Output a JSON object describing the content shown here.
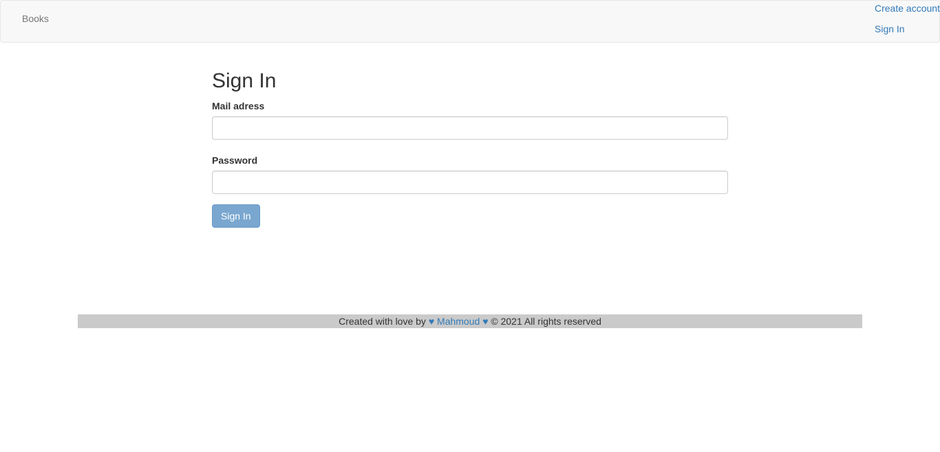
{
  "navbar": {
    "brand": "Books",
    "links": [
      {
        "label": "Create account"
      },
      {
        "label": "Sign In"
      }
    ]
  },
  "form": {
    "title": "Sign In",
    "email_label": "Mail adress",
    "email_value": "",
    "password_label": "Password",
    "password_value": "",
    "submit_label": "Sign In"
  },
  "footer": {
    "prefix": "Created with love by",
    "heart_icon": "♥",
    "author": "Mahmoud",
    "suffix": "© 2021 All rights reserved"
  },
  "colors": {
    "navbar_bg": "#f8f8f8",
    "link": "#337ab7",
    "button_bg": "#7aa7cf",
    "footer_bg": "#cacaca"
  }
}
